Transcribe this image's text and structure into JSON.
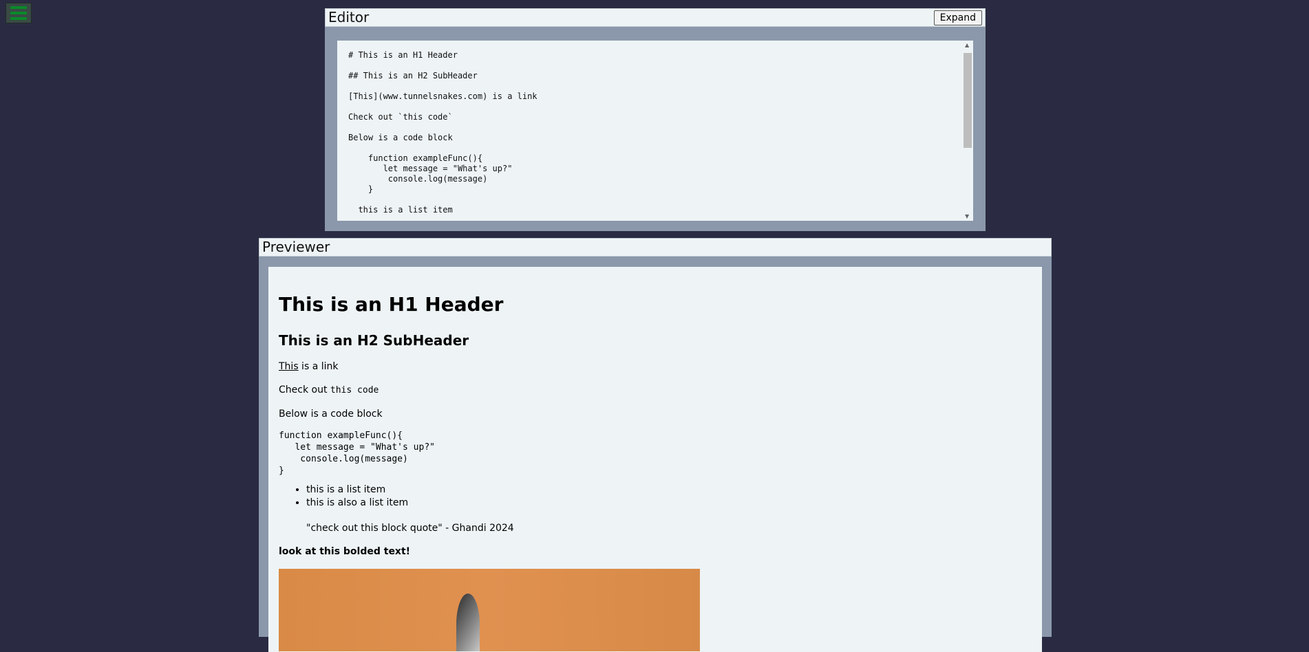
{
  "menu": {
    "icon": "hamburger-icon",
    "accent": "#0a8a2a"
  },
  "editor": {
    "title": "Editor",
    "expand_label": "Expand",
    "lines": [
      "# This is an H1 Header",
      "",
      "## This is an H2 SubHeader",
      "",
      "[This](www.tunnelsnakes.com) is a link",
      "",
      "Check out `this code`",
      "",
      "Below is a code block",
      "",
      "    function exampleFunc(){",
      "       let message = \"What's up?\"",
      "        console.log(message)",
      "    }",
      "",
      "  this is a list item"
    ]
  },
  "preview": {
    "title": "Previewer",
    "h1": "This is an H1 Header",
    "h2": "This is an H2 SubHeader",
    "link_text": "This",
    "link_rest": " is a link",
    "code_prefix": "Check out ",
    "code_inline": "this code",
    "codeblock_intro": "Below is a code block",
    "codeblock": "function exampleFunc(){\n   let message = \"What's up?\"\n    console.log(message)\n}",
    "list": [
      "this is a list item",
      "this is also a list item"
    ],
    "quote": "\"check out this block quote\" - Ghandi 2024",
    "bold": "look at this bolded text!"
  },
  "colors": {
    "background": "#2a2b42",
    "panel_frame": "#8b98ab",
    "panel_surface": "#eef4f6"
  }
}
